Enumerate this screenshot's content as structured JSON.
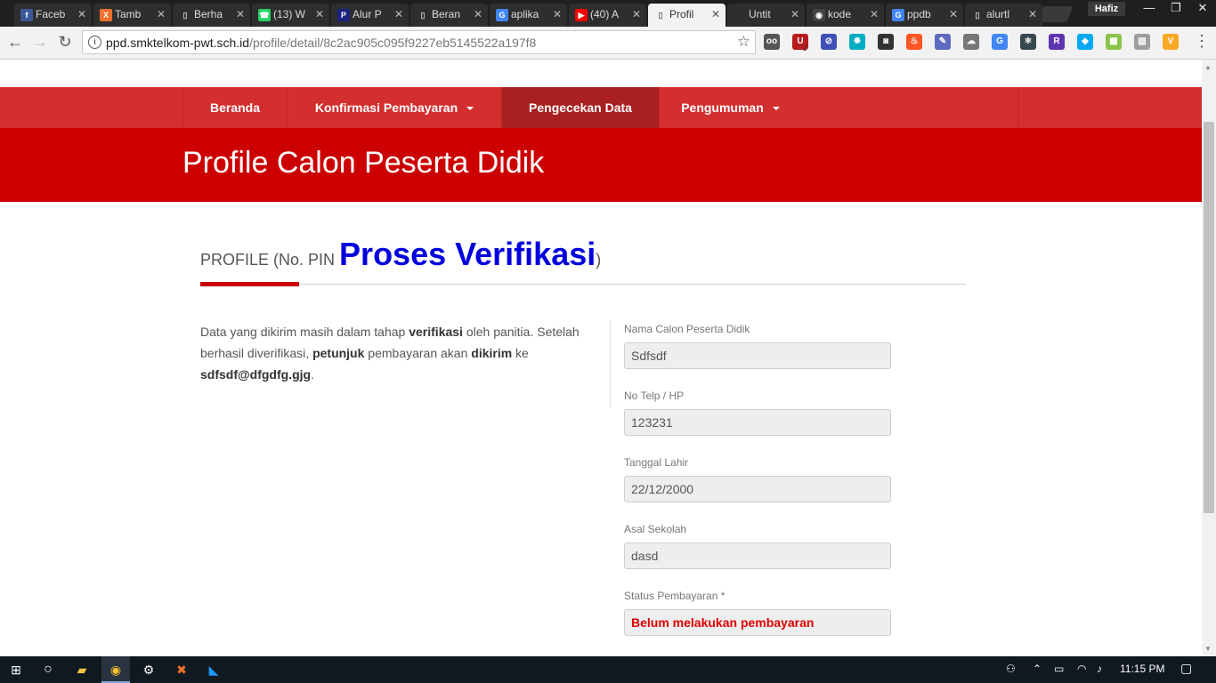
{
  "browser": {
    "tabs": [
      {
        "label": "Faceb",
        "icon": "facebook-icon",
        "color": "#3b5998",
        "glyph": "f"
      },
      {
        "label": "Tamb",
        "icon": "xampp-icon",
        "color": "#f0712c",
        "glyph": "X"
      },
      {
        "label": "Berha",
        "icon": "page-icon",
        "color": "",
        "glyph": "▯"
      },
      {
        "label": "(13) W",
        "icon": "whatsapp-icon",
        "color": "#25d366",
        "glyph": "☎"
      },
      {
        "label": "Alur P",
        "icon": "po-icon",
        "color": "#1a237e",
        "glyph": "P"
      },
      {
        "label": "Beran",
        "icon": "page-icon",
        "color": "",
        "glyph": "▯"
      },
      {
        "label": "aplika",
        "icon": "google-icon",
        "color": "#4285f4",
        "glyph": "G"
      },
      {
        "label": "(40) A",
        "icon": "youtube-icon",
        "color": "#ff0000",
        "glyph": "▶"
      },
      {
        "label": "Profil",
        "icon": "page-icon",
        "color": "",
        "glyph": "▯"
      },
      {
        "label": "Untit",
        "icon": "",
        "color": "",
        "glyph": ""
      },
      {
        "label": "kode",
        "icon": "github-icon",
        "color": "#444",
        "glyph": "◉"
      },
      {
        "label": "ppdb",
        "icon": "google-icon",
        "color": "#4285f4",
        "glyph": "G"
      },
      {
        "label": "alurtl",
        "icon": "page-icon",
        "color": "",
        "glyph": "▯"
      }
    ],
    "active_tab": 8,
    "profile_name": "Hafiz",
    "url_host": "ppd.smktelkom-pwt.sch.id",
    "url_path": "/profile/detail/8c2ac905c095f9227eb5145522a197f8",
    "extensions": [
      {
        "name": "gitpod-icon",
        "color": "#555",
        "glyph": "oo"
      },
      {
        "name": "ublock-icon",
        "color": "#b71c1c",
        "glyph": "U"
      },
      {
        "name": "block-icon",
        "color": "#3f51b5",
        "glyph": "⊘"
      },
      {
        "name": "gear-ext-icon",
        "color": "#00acc1",
        "glyph": "✹"
      },
      {
        "name": "ninja-icon",
        "color": "#333",
        "glyph": "◙"
      },
      {
        "name": "fire-icon",
        "color": "#ff5722",
        "glyph": "♨"
      },
      {
        "name": "eyedropper-icon",
        "color": "#5c6bc0",
        "glyph": "✎"
      },
      {
        "name": "cloud-icon",
        "color": "#777",
        "glyph": "☁"
      },
      {
        "name": "translate-icon",
        "color": "#4285f4",
        "glyph": "G"
      },
      {
        "name": "react-icon",
        "color": "#37474f",
        "glyph": "⚛"
      },
      {
        "name": "redux-icon",
        "color": "#5e35b1",
        "glyph": "R"
      },
      {
        "name": "drop-icon",
        "color": "#03a9f4",
        "glyph": "◆"
      },
      {
        "name": "colorzilla-icon",
        "color": "#8bc34a",
        "glyph": "▦"
      },
      {
        "name": "screenshot-icon",
        "color": "#9e9e9e",
        "glyph": "▧"
      },
      {
        "name": "vue-icon",
        "color": "#f9a825",
        "glyph": "V"
      }
    ],
    "ublock_badge": "2"
  },
  "nav": {
    "items": [
      {
        "label": "Beranda",
        "dropdown": false,
        "active": false
      },
      {
        "label": "Konfirmasi Pembayaran",
        "dropdown": true,
        "active": false
      },
      {
        "label": "Pengecekan Data",
        "dropdown": false,
        "active": true
      },
      {
        "label": "Pengumuman",
        "dropdown": true,
        "active": false
      }
    ]
  },
  "hero": {
    "title": "Profile Calon Peserta Didik"
  },
  "section": {
    "prefix": "PROFILE (No. PIN ",
    "pin_status": "Proses Verifikasi",
    "suffix": ")"
  },
  "message": {
    "t1": "Data yang dikirim masih dalam tahap ",
    "b1": "verifikasi",
    "t2": " oleh panitia. Setelah berhasil diverifikasi, ",
    "b2": "petunjuk",
    "t3": " pembayaran akan ",
    "b3": "dikirim",
    "t4": " ke ",
    "email": "sdfsdf@dfgdfg.gjg",
    "t5": "."
  },
  "fields": [
    {
      "label": "Nama Calon Peserta Didik",
      "value": "Sdfsdf"
    },
    {
      "label": "No Telp / HP",
      "value": "123231"
    },
    {
      "label": "Tanggal Lahir",
      "value": "22/12/2000"
    },
    {
      "label": "Asal Sekolah",
      "value": "dasd"
    },
    {
      "label": "Status Pembayaran *",
      "value": "Belum melakukan pembayaran",
      "status": "danger"
    }
  ],
  "taskbar": {
    "time": "11:15 PM"
  },
  "colors": {
    "brand_red": "#cc0000",
    "nav_red": "#d32f2f",
    "pin_blue": "#0000dd",
    "status_red": "#dd0000"
  }
}
